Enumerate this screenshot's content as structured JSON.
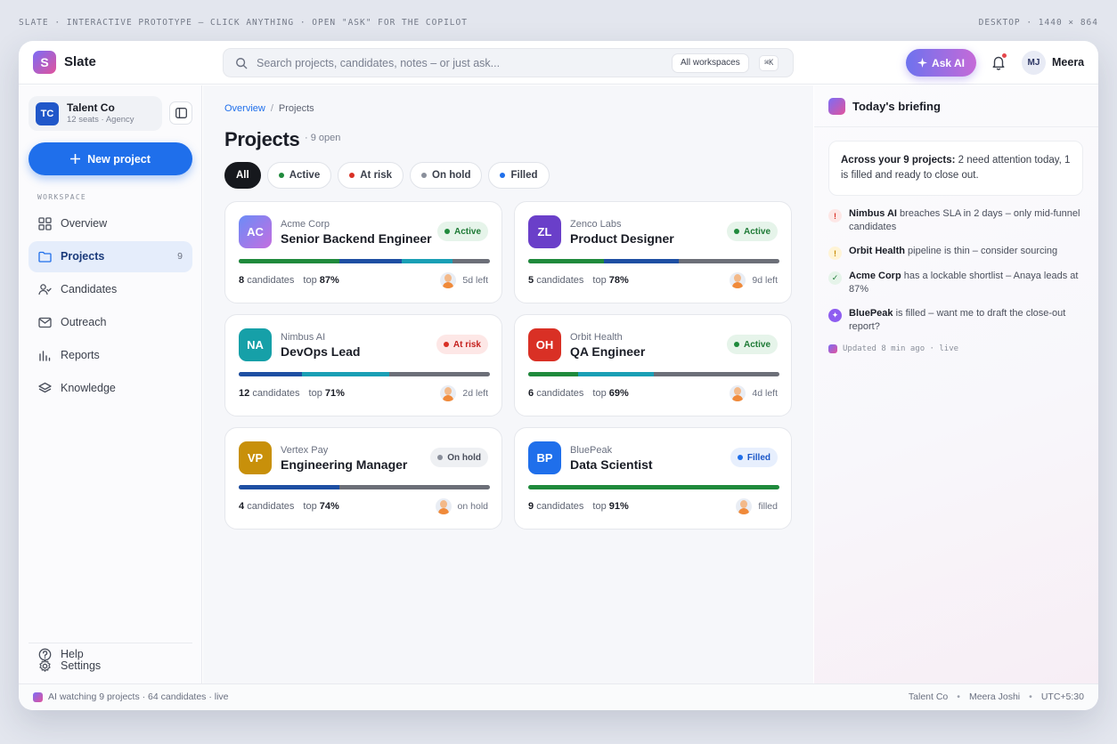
{
  "top_strip": {
    "left": "SLATE · INTERACTIVE PROTOTYPE — CLICK ANYTHING · OPEN \"ASK\" FOR THE COPILOT",
    "right": "DESKTOP · 1440 × 864"
  },
  "header": {
    "logo_letter": "S",
    "app_name": "Slate",
    "search_placeholder": "Search projects, candidates, notes – or just ask...",
    "workspace_scope": "All workspaces",
    "shortcut": "⌘K",
    "ask_ai_label": "Ask AI",
    "user_initials": "MJ",
    "user_name": "Meera"
  },
  "sidebar": {
    "org": {
      "initials": "TC",
      "name": "Talent Co",
      "sub": "12 seats · Agency"
    },
    "new_project_label": "New project",
    "workspace_label": "WORKSPACE",
    "items": [
      {
        "label": "Overview"
      },
      {
        "label": "Projects",
        "count": "9",
        "active": true
      },
      {
        "label": "Candidates"
      },
      {
        "label": "Outreach"
      },
      {
        "label": "Reports"
      },
      {
        "label": "Knowledge"
      }
    ],
    "bottom_items": [
      {
        "label": "Settings"
      },
      {
        "label": "Help"
      }
    ]
  },
  "main": {
    "breadcrumb": {
      "root": "Overview",
      "sep": "/",
      "current": "Projects"
    },
    "title": "Projects",
    "subtitle": "· 9 open",
    "filters": [
      {
        "label": "All",
        "selected": true
      },
      {
        "label": "Active",
        "dot": "#1f8a3c"
      },
      {
        "label": "At risk",
        "dot": "#d93025"
      },
      {
        "label": "On hold",
        "dot": "#8a8f9b"
      },
      {
        "label": "Filled",
        "dot": "#1f6feb"
      }
    ],
    "projects": [
      {
        "initials": "AC",
        "company": "Acme Corp",
        "role": "Senior Backend Engineer",
        "status": "Active",
        "candidates": "8",
        "candidates_label": "candidates",
        "top_label": "top",
        "top": "87%",
        "due": "5d left",
        "avatar_bg": "linear-gradient(135deg,#6b8cf7,#c46ee0)",
        "badge_bg": "#e6f4ea",
        "badge_fg": "#1e7a36",
        "badge_dot": "#1f8a3c",
        "segments": [
          {
            "c": "#1f8a3c",
            "w": 40
          },
          {
            "c": "#1e4fa3",
            "w": 25
          },
          {
            "c": "#1a9fb5",
            "w": 20
          }
        ]
      },
      {
        "initials": "ZL",
        "company": "Zenco Labs",
        "role": "Product Designer",
        "status": "Active",
        "candidates": "5",
        "candidates_label": "candidates",
        "top_label": "top",
        "top": "78%",
        "due": "9d left",
        "avatar_bg": "#6a3fc9",
        "badge_bg": "#e6f4ea",
        "badge_fg": "#1e7a36",
        "badge_dot": "#1f8a3c",
        "segments": [
          {
            "c": "#1f8a3c",
            "w": 30
          },
          {
            "c": "#1e4fa3",
            "w": 30
          }
        ]
      },
      {
        "initials": "NA",
        "company": "Nimbus AI",
        "role": "DevOps Lead",
        "status": "At risk",
        "candidates": "12",
        "candidates_label": "candidates",
        "top_label": "top",
        "top": "71%",
        "due": "2d left",
        "avatar_bg": "#16a0a8",
        "badge_bg": "#fde7e6",
        "badge_fg": "#c5221f",
        "badge_dot": "#d93025",
        "segments": [
          {
            "c": "#1e4fa3",
            "w": 25
          },
          {
            "c": "#1a9fb5",
            "w": 35
          }
        ]
      },
      {
        "initials": "OH",
        "company": "Orbit Health",
        "role": "QA Engineer",
        "status": "Active",
        "candidates": "6",
        "candidates_label": "candidates",
        "top_label": "top",
        "top": "69%",
        "due": "4d left",
        "avatar_bg": "#d93025",
        "badge_bg": "#e6f4ea",
        "badge_fg": "#1e7a36",
        "badge_dot": "#1f8a3c",
        "segments": [
          {
            "c": "#1f8a3c",
            "w": 20
          },
          {
            "c": "#1a9fb5",
            "w": 30
          }
        ]
      },
      {
        "initials": "VP",
        "company": "Vertex Pay",
        "role": "Engineering Manager",
        "status": "On hold",
        "candidates": "4",
        "candidates_label": "candidates",
        "top_label": "top",
        "top": "74%",
        "due": "on hold",
        "avatar_bg": "#c8900a",
        "badge_bg": "#eef0f3",
        "badge_fg": "#4a4f5c",
        "badge_dot": "#8a8f9b",
        "segments": [
          {
            "c": "#1e4fa3",
            "w": 40
          }
        ]
      },
      {
        "initials": "BP",
        "company": "BluePeak",
        "role": "Data Scientist",
        "status": "Filled",
        "candidates": "9",
        "candidates_label": "candidates",
        "top_label": "top",
        "top": "91%",
        "due": "filled",
        "avatar_bg": "#1f6feb",
        "badge_bg": "#e7effd",
        "badge_fg": "#1a56c8",
        "badge_dot": "#1f6feb",
        "segments": [
          {
            "c": "#1f8a3c",
            "w": 100
          }
        ]
      }
    ]
  },
  "briefing": {
    "title": "Today's briefing",
    "summary_bold": "Across your 9 projects:",
    "summary_text": " 2 need attention today, 1 is filled and ready to close out.",
    "items": [
      {
        "icon": "!",
        "icon_bg": "#fde7e6",
        "icon_fg": "#d93025",
        "bold": "Nimbus AI",
        "text": " breaches SLA in 2 days – only mid-funnel candidates"
      },
      {
        "icon": "!",
        "icon_bg": "#fff4d6",
        "icon_fg": "#c88a00",
        "bold": "Orbit Health",
        "text": " pipeline is thin – consider sourcing"
      },
      {
        "icon": "✓",
        "icon_bg": "#e6f4ea",
        "icon_fg": "#1e7a36",
        "bold": "Acme Corp",
        "text": " has a lockable shortlist – Anaya leads at 87%"
      },
      {
        "icon": "✦",
        "icon_bg": "#8e5df0",
        "icon_fg": "#ffffff",
        "bold": "BluePeak",
        "text": " is filled – want me to draft the close-out report?"
      }
    ],
    "updated": "Updated 8 min ago · live"
  },
  "footer": {
    "left": "AI watching 9 projects · 64 candidates · live",
    "org": "Talent Co",
    "user": "Meera Joshi",
    "tz": "UTC+5:30",
    "dot": "•"
  }
}
